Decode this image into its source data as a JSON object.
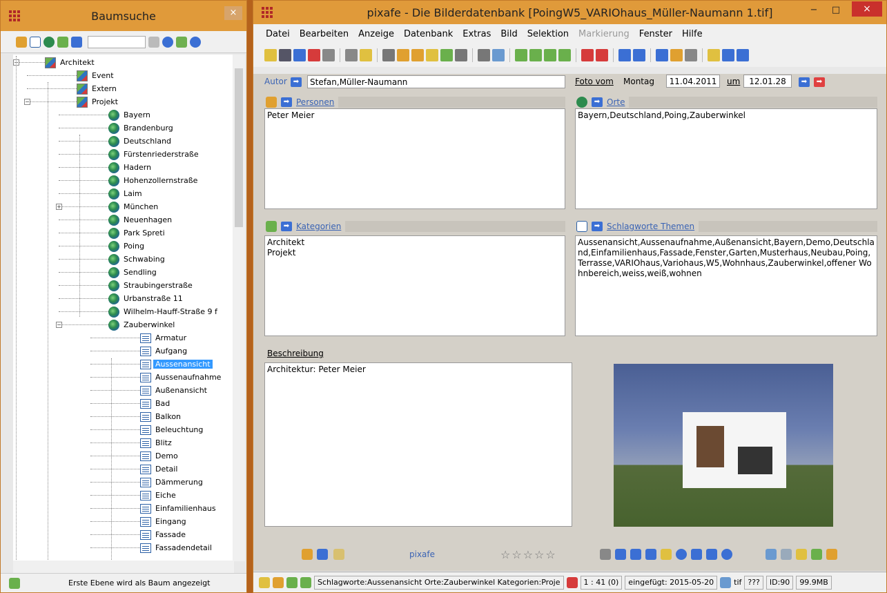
{
  "tree_window": {
    "title": "Baumsuche",
    "close": "×",
    "status": "Erste Ebene wird als Baum angezeigt",
    "nodes": [
      {
        "label": "Architekt",
        "icon": "folder-icon",
        "level": 0,
        "expander": "⊟"
      },
      {
        "label": "Event",
        "icon": "folder-icon",
        "level": 1
      },
      {
        "label": "Extern",
        "icon": "folder-icon",
        "level": 1
      },
      {
        "label": "Projekt",
        "icon": "folder-icon",
        "level": 1,
        "expander": "⊟"
      },
      {
        "label": "Bayern",
        "icon": "globe-icon",
        "level": 2
      },
      {
        "label": "Brandenburg",
        "icon": "globe-icon",
        "level": 2
      },
      {
        "label": "Deutschland",
        "icon": "globe-icon",
        "level": 2
      },
      {
        "label": "Fürstenriederstraße",
        "icon": "globe-icon",
        "level": 2
      },
      {
        "label": "Hadern",
        "icon": "globe-icon",
        "level": 2
      },
      {
        "label": "Hohenzollernstraße",
        "icon": "globe-icon",
        "level": 2
      },
      {
        "label": "Laim",
        "icon": "globe-icon",
        "level": 2
      },
      {
        "label": "München",
        "icon": "globe-icon",
        "level": 2,
        "expander": "⊞"
      },
      {
        "label": "Neuenhagen",
        "icon": "globe-icon",
        "level": 2
      },
      {
        "label": "Park Spreti",
        "icon": "globe-icon",
        "level": 2
      },
      {
        "label": "Poing",
        "icon": "globe-icon",
        "level": 2
      },
      {
        "label": "Schwabing",
        "icon": "globe-icon",
        "level": 2
      },
      {
        "label": "Sendling",
        "icon": "globe-icon",
        "level": 2
      },
      {
        "label": "Straubingerstraße",
        "icon": "globe-icon",
        "level": 2
      },
      {
        "label": "Urbanstraße 11",
        "icon": "globe-icon",
        "level": 2
      },
      {
        "label": "Wilhelm-Hauff-Straße 9 f",
        "icon": "globe-icon",
        "level": 2
      },
      {
        "label": "Zauberwinkel",
        "icon": "globe-icon",
        "level": 2,
        "expander": "⊟"
      },
      {
        "label": "Armatur",
        "icon": "tag-icon",
        "level": 3
      },
      {
        "label": "Aufgang",
        "icon": "tag-icon",
        "level": 3
      },
      {
        "label": "Aussenansicht",
        "icon": "tag-icon",
        "level": 3,
        "selected": true
      },
      {
        "label": "Aussenaufnahme",
        "icon": "tag-icon",
        "level": 3
      },
      {
        "label": "Außenansicht",
        "icon": "tag-icon",
        "level": 3
      },
      {
        "label": "Bad",
        "icon": "tag-icon",
        "level": 3
      },
      {
        "label": "Balkon",
        "icon": "tag-icon",
        "level": 3
      },
      {
        "label": "Beleuchtung",
        "icon": "tag-icon",
        "level": 3
      },
      {
        "label": "Blitz",
        "icon": "tag-icon",
        "level": 3
      },
      {
        "label": "Demo",
        "icon": "tag-icon",
        "level": 3
      },
      {
        "label": "Detail",
        "icon": "tag-icon",
        "level": 3
      },
      {
        "label": "Dämmerung",
        "icon": "tag-icon",
        "level": 3
      },
      {
        "label": "Eiche",
        "icon": "tag-icon",
        "level": 3
      },
      {
        "label": "Einfamilienhaus",
        "icon": "tag-icon",
        "level": 3
      },
      {
        "label": "Eingang",
        "icon": "tag-icon",
        "level": 3
      },
      {
        "label": "Fassade",
        "icon": "tag-icon",
        "level": 3
      },
      {
        "label": "Fassadendetail",
        "icon": "tag-icon",
        "level": 3
      }
    ]
  },
  "main_window": {
    "title": "pixafe - Die Bilderdatenbank  [PoingW5_VARIOhaus_Müller-Naumann 1.tif]",
    "minimize": "−",
    "maximize": "□",
    "close": "×",
    "menu": [
      "Datei",
      "Bearbeiten",
      "Anzeige",
      "Datenbank",
      "Extras",
      "Bild",
      "Selektion",
      "Markierung",
      "Fenster",
      "Hilfe"
    ],
    "menu_disabled": "Markierung"
  },
  "form": {
    "autor_label": "Autor",
    "autor_value": "Stefan,Müller-Naumann",
    "foto_vom_label": "Foto vom",
    "weekday": "Montag",
    "date": "11.04.2011",
    "um_label": "um",
    "time": "12.01.28",
    "personen_label": "Personen",
    "personen_value": "Peter Meier",
    "orte_label": "Orte",
    "orte_value": "Bayern,Deutschland,Poing,Zauberwinkel",
    "kategorien_label": "Kategorien",
    "kategorien_value": "Architekt\nProjekt",
    "schlagworte_label": "Schlagworte Themen",
    "schlagworte_value": "Aussenansicht,Aussenaufnahme,Außenansicht,Bayern,Demo,Deutschland,Einfamilienhaus,Fassade,Fenster,Garten,Musterhaus,Neubau,Poing,Terrasse,VARIOhaus,Variohaus,W5,Wohnhaus,Zauberwinkel,offener Wohnbereich,weiss,weiß,wohnen",
    "beschreibung_label": "Beschreibung",
    "beschreibung_value": "Architektur: Peter Meier",
    "arrow_glyph": "➡",
    "pixafe_link": "pixafe",
    "stars": "☆☆☆☆☆"
  },
  "status": {
    "info": "Schlagworte:Aussenansicht Orte:Zauberwinkel Kategorien:Proje",
    "position": "1 : 41 (0)",
    "inserted": "eingefügt: 2015-05-20",
    "type": "tif",
    "unknown": "???",
    "id": "ID:90",
    "size": "99.9MB"
  }
}
